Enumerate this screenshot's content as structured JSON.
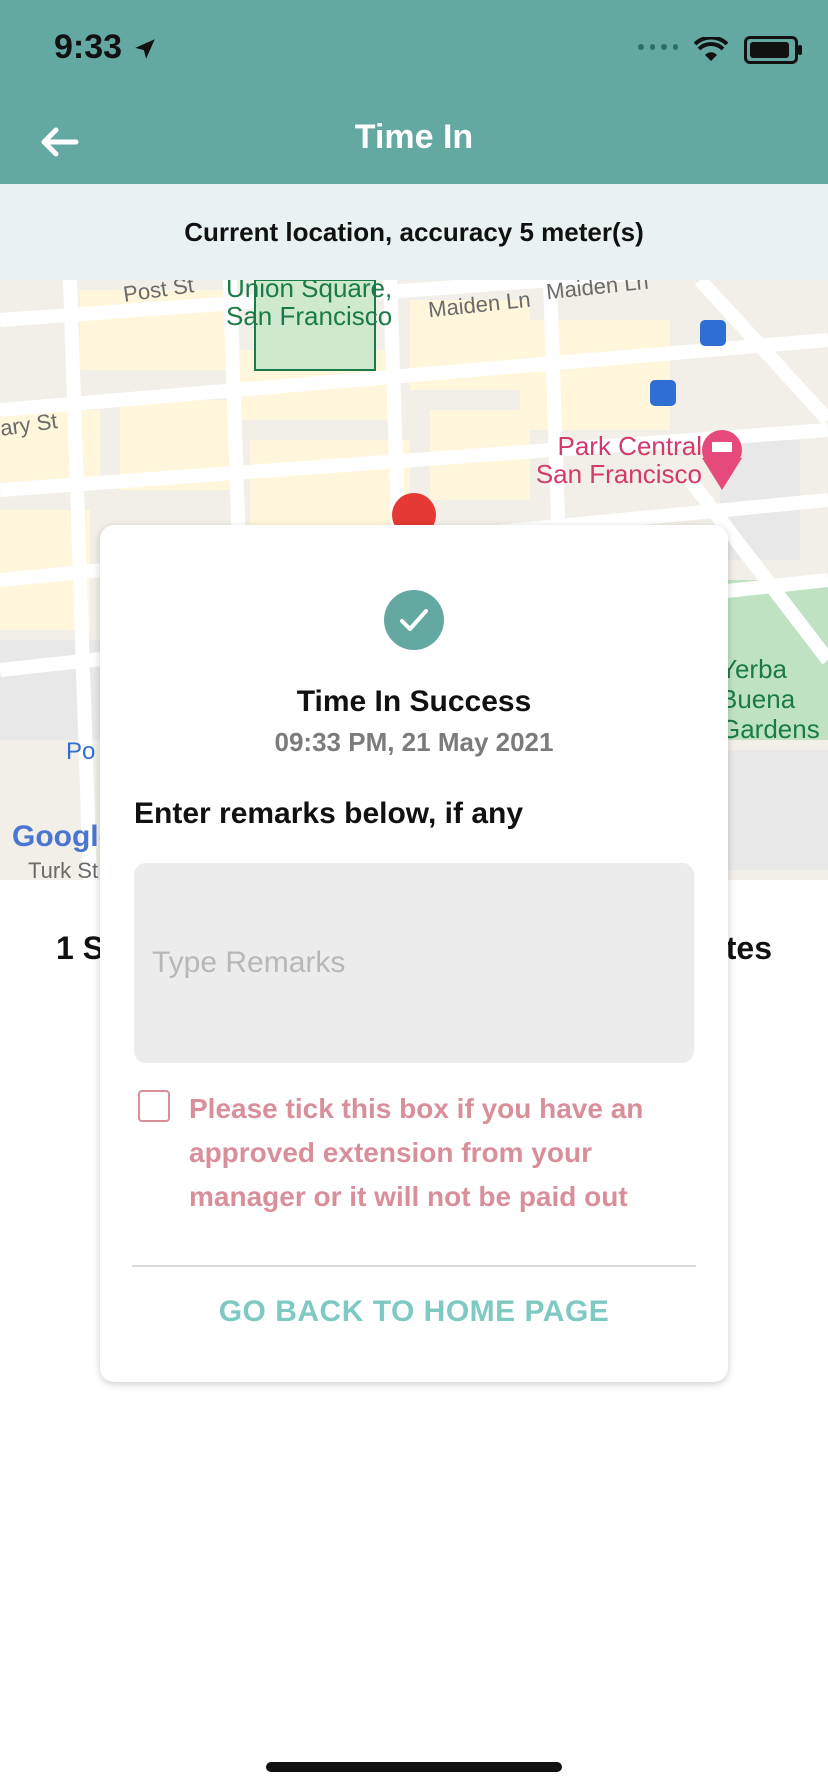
{
  "status_bar": {
    "time": "9:33"
  },
  "header": {
    "title": "Time In"
  },
  "location_bar": {
    "text": "Current location, accuracy 5 meter(s)"
  },
  "map": {
    "labels": {
      "post_st": "Post St",
      "union_square": "Union Square, San Francisco",
      "maiden_ln_1": "Maiden Ln",
      "maiden_ln_2": "Maiden Ln",
      "ary_st": "ary St",
      "park_central": "Park Central San Francisco",
      "yerba_buena": "Yerba Buena Gardens",
      "po": "Po",
      "turk_st": "Turk St",
      "google": "Google"
    }
  },
  "summary": {
    "left": "1 S",
    "right": "tes"
  },
  "modal": {
    "title": "Time In Success",
    "datetime": "09:33 PM, 21 May 2021",
    "remarks_label": "Enter remarks below, if any",
    "remarks_placeholder": "Type Remarks",
    "consent_text": "Please tick this box if you have an approved extension from your manager or it will not be paid out",
    "home_button": "GO BACK TO HOME PAGE"
  },
  "colors": {
    "header_bg": "#64a8a2",
    "location_bg": "#e9f2f1",
    "accent": "#64a8a2",
    "warning_text": "#d98f9a",
    "home_button_text": "#7ec9c1"
  }
}
